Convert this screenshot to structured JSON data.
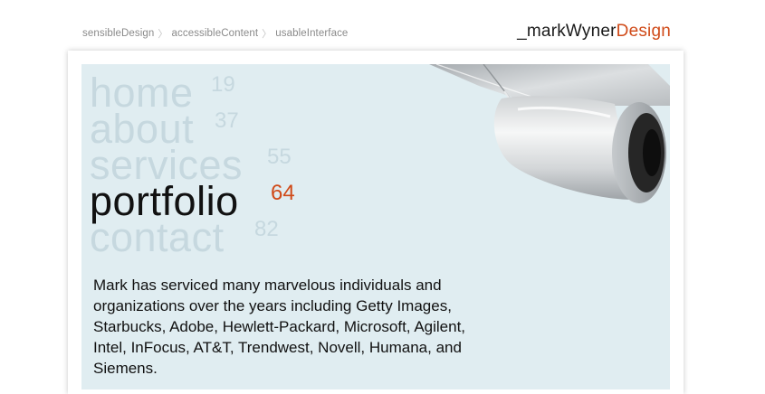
{
  "tagline": [
    "sensibleDesign",
    "accessibleContent",
    "usableInterface"
  ],
  "tagline_separator": "〉",
  "brand": {
    "prefix": "_markWyner",
    "accent": "Design"
  },
  "nav": [
    {
      "label": "home",
      "number": "19",
      "active": false
    },
    {
      "label": "about",
      "number": "37",
      "active": false
    },
    {
      "label": "services",
      "number": "55",
      "active": false
    },
    {
      "label": "portfolio",
      "number": "64",
      "active": true
    },
    {
      "label": "contact",
      "number": "82",
      "active": false
    }
  ],
  "description": "Mark has serviced many marvelous individuals and organizations over the years including Getty Images, Starbucks, Adobe, Hewlett-Packard, Microsoft, Agilent, Intel, InFocus, AT&T, Trendwest, Novell, Humana, and Siemens.",
  "colors": {
    "accent": "#d04a18",
    "panel": "#e0edf1",
    "nav_inactive": "#c6d8df",
    "nav_active": "#111111"
  },
  "image": "jet-engine-illustration"
}
